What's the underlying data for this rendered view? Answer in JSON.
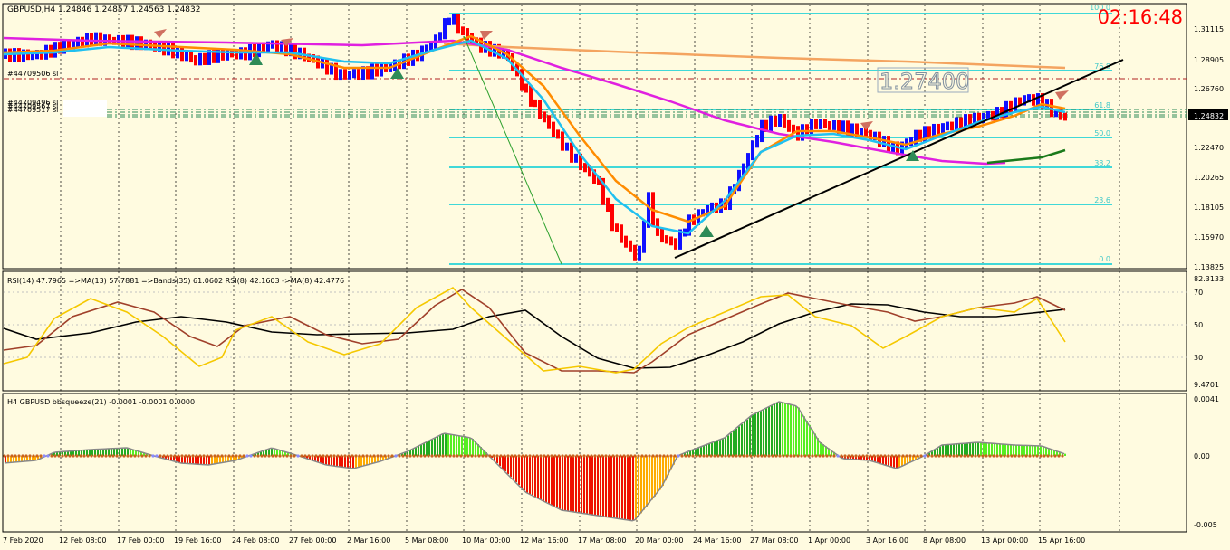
{
  "main": {
    "header": "GBPUSD,H4  1.24846 1.24857 1.24563 1.24832",
    "clock": "02:16:48",
    "big_label": "1.27400",
    "current_price": "1.24832",
    "order_labels": [
      "#44709506 sl",
      "#44709496 sl",
      "#44709567 sl",
      "#44709517 sl"
    ],
    "price_ticks": [
      "1.31115",
      "1.28905",
      "1.26760",
      "1.24832",
      "1.22470",
      "1.20265",
      "1.18105",
      "1.15970",
      "1.13825"
    ],
    "fib_labels": [
      "100.0",
      "76.8",
      "61.8",
      "50.0",
      "38.2",
      "23.6",
      "0.0"
    ]
  },
  "rsi": {
    "header": "RSI(14) 47.7965  =>MA(13) 57.7881  =>Bands(35) 61.0602  RSI(8) 42.1603  ->MA(8) 42.4776",
    "ticks": [
      "82.3133",
      "70",
      "50",
      "30",
      "9.4701"
    ]
  },
  "squeeze": {
    "header": "H4 GBPUSD bbsqueeze(21) -0.0001 -0.0001 0.0000",
    "ticks": [
      "0.0041",
      "0.00",
      "-0.005"
    ]
  },
  "time_axis": [
    "7 Feb 2020",
    "12 Feb 08:00",
    "17 Feb 00:00",
    "19 Feb 16:00",
    "24 Feb 08:00",
    "27 Feb 00:00",
    "2 Mar 16:00",
    "5 Mar 08:00",
    "10 Mar 00:00",
    "12 Mar 16:00",
    "17 Mar 08:00",
    "20 Mar 00:00",
    "24 Mar 16:00",
    "27 Mar 08:00",
    "1 Apr 00:00",
    "3 Apr 16:00",
    "8 Apr 08:00",
    "13 Apr 00:00",
    "15 Apr 16:00"
  ],
  "colors": {
    "background": "#fffbe0",
    "up": "#1010ff",
    "down": "#ff0000",
    "fib": "#40d8d8",
    "clock": "#ff0000"
  }
}
